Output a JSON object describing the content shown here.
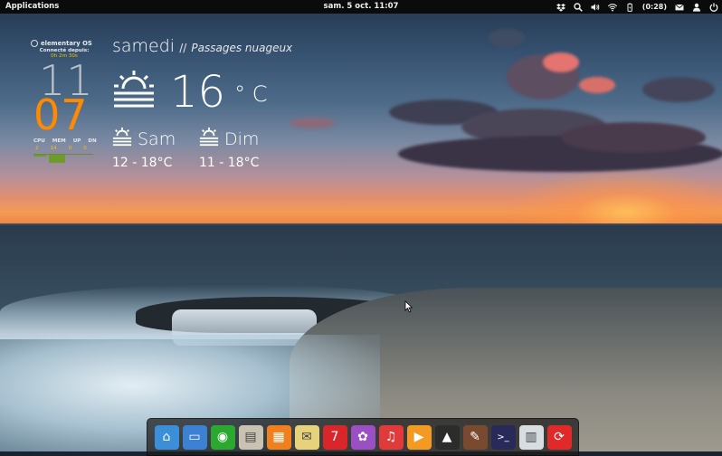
{
  "top_panel": {
    "applications_label": "Applications",
    "clock": "sam.  5 oct. 11:07",
    "battery_time": "(0:28)",
    "indicator_icons": [
      "dropbox-icon",
      "search-icon",
      "volume-icon",
      "wifi-icon",
      "battery-icon",
      "mail-icon",
      "user-icon",
      "power-icon"
    ]
  },
  "conky": {
    "os_name": "elementary OS",
    "connected_label": "Connecté depuis:",
    "uptime": "0h 2m 30s",
    "hour": "11",
    "minute": "07",
    "minute_color": "#ff8a00",
    "stats": {
      "headers": [
        "CPU",
        "MEM",
        "UP",
        "DN"
      ],
      "values": [
        "2",
        "14",
        "0",
        "0"
      ]
    }
  },
  "weather": {
    "day": "samedi",
    "separator": "//",
    "description": "Passages nuageux",
    "current_temp": "16",
    "unit": "° C",
    "forecast": [
      {
        "day": "Sam",
        "range": "12 - 18°C"
      },
      {
        "day": "Dim",
        "range": "11 - 18°C"
      }
    ]
  },
  "dock": {
    "items": [
      {
        "name": "files",
        "icon": "home-folder-icon",
        "color": "#3b8fd8",
        "glyph": "⌂"
      },
      {
        "name": "workspaces",
        "icon": "multitasking-view-icon",
        "color": "#3d82d2",
        "glyph": "▭"
      },
      {
        "name": "web-browser",
        "icon": "chromium-icon",
        "color": "#2aa830",
        "glyph": "◉"
      },
      {
        "name": "document-viewer",
        "icon": "document-icon",
        "color": "#c9c2b2",
        "glyph": "▤"
      },
      {
        "name": "office-suite",
        "icon": "grid-apps-icon",
        "color": "#f07f1e",
        "glyph": "▦"
      },
      {
        "name": "mail",
        "icon": "envelope-icon",
        "color": "#e6d27a",
        "glyph": "✉"
      },
      {
        "name": "calendar",
        "icon": "calendar-icon",
        "color": "#d9262a",
        "glyph": "7"
      },
      {
        "name": "photo-viewer",
        "icon": "shotwell-icon",
        "color": "#9a4fc2",
        "glyph": "✿"
      },
      {
        "name": "music",
        "icon": "music-note-icon",
        "color": "#e03a3a",
        "glyph": "♫"
      },
      {
        "name": "video-player",
        "icon": "play-icon",
        "color": "#f39a22",
        "glyph": "▶"
      },
      {
        "name": "image-viewer",
        "icon": "landscape-picture-icon",
        "color": "#2c2c2c",
        "glyph": "▲"
      },
      {
        "name": "gimp",
        "icon": "gimp-icon",
        "color": "#7a4a30",
        "glyph": "✎"
      },
      {
        "name": "terminal",
        "icon": "terminal-icon",
        "color": "#2a2a5a",
        "glyph": ">_"
      },
      {
        "name": "system-settings",
        "icon": "settings-panels-icon",
        "color": "#d8dde2",
        "glyph": "▥"
      },
      {
        "name": "software-update",
        "icon": "update-arrows-icon",
        "color": "#e02a2a",
        "glyph": "⟳"
      }
    ]
  }
}
